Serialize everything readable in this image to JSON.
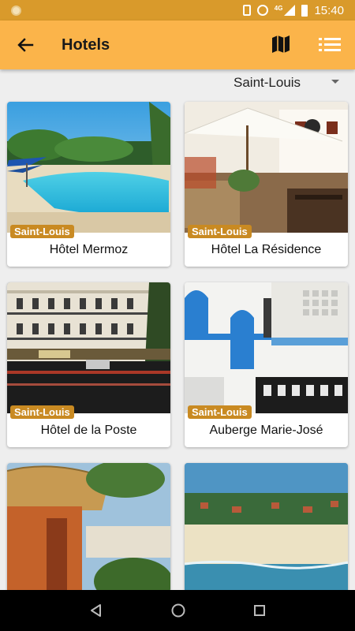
{
  "status_bar": {
    "time": "15:40",
    "network": "4G"
  },
  "app_bar": {
    "title": "Hotels"
  },
  "filter": {
    "city": "Saint-Louis"
  },
  "hotels": [
    {
      "name": "Hôtel Mermoz",
      "city": "Saint-Louis"
    },
    {
      "name": "Hôtel La Résidence",
      "city": "Saint-Louis"
    },
    {
      "name": "Hôtel de la Poste",
      "city": "Saint-Louis"
    },
    {
      "name": "Auberge Marie-José",
      "city": "Saint-Louis"
    },
    {
      "name": "",
      "city": ""
    },
    {
      "name": "",
      "city": ""
    }
  ],
  "colors": {
    "app_bar": "#fbb44a",
    "status_bar": "#d99a2b",
    "badge": "#c98a22"
  },
  "icons": [
    "back-arrow-icon",
    "map-icon",
    "list-icon",
    "nav-back-icon",
    "nav-home-icon",
    "nav-recents-icon"
  ]
}
